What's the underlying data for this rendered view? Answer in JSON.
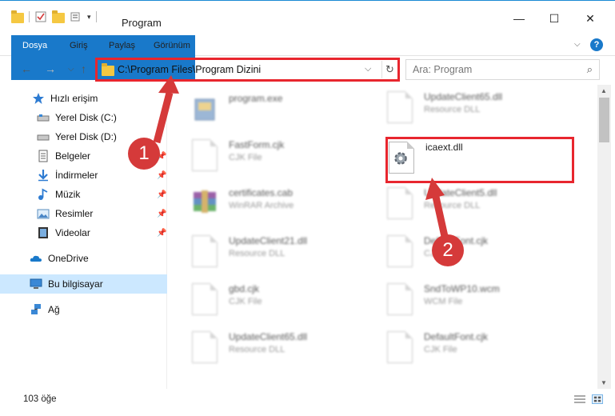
{
  "window": {
    "title": "Program",
    "minimize_glyph": "—",
    "maximize_glyph": "☐",
    "close_glyph": "✕"
  },
  "ribbon": {
    "tabs": [
      "Dosya",
      "Giriş",
      "Paylaş",
      "Görünüm"
    ],
    "help_glyph": "?"
  },
  "address_bar": {
    "path": "C:\\Program Files\\Program Dizini",
    "dropdown_glyph": "⌵",
    "refresh_glyph": "↻"
  },
  "search": {
    "placeholder": "Ara: Program",
    "icon_glyph": "⌕"
  },
  "nav": {
    "back_glyph": "←",
    "forward_glyph": "→",
    "recent_glyph": "⌵",
    "up_glyph": "↑"
  },
  "sidebar": {
    "items": [
      {
        "label": "Hızlı erişim",
        "icon": "star-icon"
      },
      {
        "label": "Yerel Disk (C:)",
        "icon": "drive-icon"
      },
      {
        "label": "Yerel Disk (D:)",
        "icon": "drive-icon"
      },
      {
        "label": "Belgeler",
        "icon": "documents-icon"
      },
      {
        "label": "İndirmeler",
        "icon": "download-icon"
      },
      {
        "label": "Müzik",
        "icon": "music-icon"
      },
      {
        "label": "Resimler",
        "icon": "pictures-icon"
      },
      {
        "label": "Videolar",
        "icon": "video-icon"
      },
      {
        "label": "OneDrive",
        "icon": "cloud-icon"
      },
      {
        "label": "Bu bilgisayar",
        "icon": "computer-icon"
      },
      {
        "label": "Ağ",
        "icon": "network-icon"
      }
    ],
    "pin_glyph": "📌"
  },
  "files": [
    {
      "name": "program.exe",
      "type": ""
    },
    {
      "name": "UpdateClient65.dll",
      "type": "Resource DLL"
    },
    {
      "name": "FastForm.cjk",
      "type": "CJK File"
    },
    {
      "name": "icaext.dll",
      "type": ""
    },
    {
      "name": "certificates.cab",
      "type": "WinRAR Archive"
    },
    {
      "name": "UpdateClient5.dll",
      "type": "Resource DLL"
    },
    {
      "name": "UpdateClient21.dll",
      "type": "Resource DLL"
    },
    {
      "name": "DefaultFont.cjk",
      "type": "CJK File"
    },
    {
      "name": "gbd.cjk",
      "type": "CJK File"
    },
    {
      "name": "SndToWP10.wcm",
      "type": "WCM File"
    },
    {
      "name": "UpdateClient65.dll",
      "type": "Resource DLL"
    },
    {
      "name": "DefaultFont.cjk",
      "type": "CJK File"
    }
  ],
  "annotations": {
    "step1": "1",
    "step2": "2"
  },
  "status": {
    "count": "103 öğe"
  },
  "colors": {
    "accent": "#1979ca",
    "highlight": "#e8262e",
    "badge": "#d53a3a",
    "selected": "#cce8ff"
  }
}
